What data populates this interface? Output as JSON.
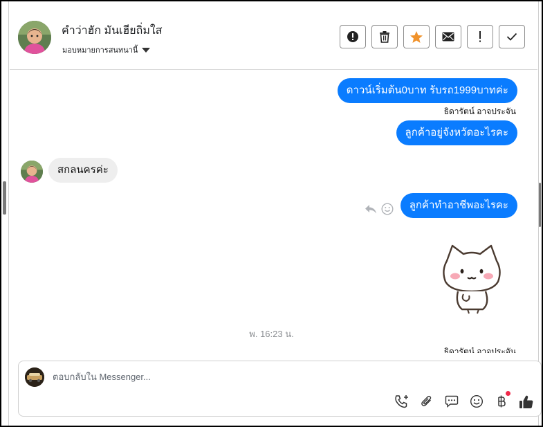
{
  "header": {
    "contact_name": "คำว่าฮัก มันเฮียถิ่มใส",
    "assign_label": "มอบหมายการสนทนานี้",
    "actions": [
      {
        "name": "spam-button",
        "icon": "alert-circle-icon"
      },
      {
        "name": "delete-button",
        "icon": "trash-icon"
      },
      {
        "name": "star-button",
        "icon": "star-icon"
      },
      {
        "name": "mark-unread-button",
        "icon": "envelope-icon"
      },
      {
        "name": "priority-button",
        "icon": "exclamation-icon"
      },
      {
        "name": "done-button",
        "icon": "check-icon"
      }
    ]
  },
  "messages": {
    "out_1": "ดาวน์เริ่มต้น0บาท รับรถ1999บาทค่ะ",
    "sender_1": "ธิดารัตน์ อาจประจัน",
    "out_2": "ลูกค้าอยู่จังหวัดอะไรคะ",
    "in_1": "สกลนครค่ะ",
    "out_3": "ลูกค้าทำอาชีพอะไรคะ",
    "sticker": "cat-sticker",
    "timestamp": "พ. 16:23 น.",
    "sender_2": "ธิดารัตน์ อาจประจัน"
  },
  "composer": {
    "placeholder": "ตอบกลับใน Messenger...",
    "tools": [
      "call-add-icon",
      "paperclip-icon",
      "chat-bubble-icon",
      "smiley-icon",
      "baht-icon",
      "thumbs-up-icon"
    ]
  },
  "colors": {
    "accent": "#0a7cff",
    "star": "#f0922b",
    "notification_dot": "#f02849"
  }
}
